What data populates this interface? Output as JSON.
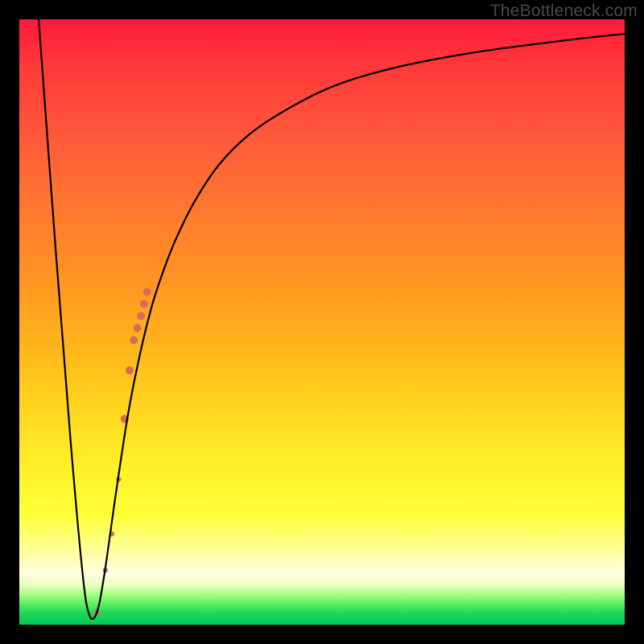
{
  "watermark": "TheBottleneck.com",
  "chart_data": {
    "type": "line",
    "title": "",
    "xlabel": "",
    "ylabel": "",
    "xlim": [
      0,
      100
    ],
    "ylim": [
      0,
      100
    ],
    "curve": {
      "x": [
        3.2,
        6,
        8.5,
        10.5,
        11.6,
        12.8,
        14,
        16,
        18,
        20,
        22,
        24,
        26,
        29,
        33,
        38,
        44,
        52,
        62,
        75,
        90,
        100
      ],
      "y": [
        100,
        62,
        30,
        8,
        1.5,
        2,
        8,
        22,
        35,
        45,
        53,
        59,
        64,
        70,
        76,
        81,
        85,
        89,
        92,
        94.5,
        96.5,
        97.6
      ]
    },
    "markers": {
      "x": [
        12.8,
        14.2,
        15.3,
        16.4,
        17.4,
        18.2,
        18.9,
        19.5,
        20.1,
        20.6,
        21.1
      ],
      "y": [
        2,
        9,
        15,
        24,
        34,
        42,
        47,
        49,
        51,
        53,
        55
      ],
      "size": [
        3.8,
        3.2,
        3.2,
        3.2,
        5.0,
        5.0,
        5.0,
        5.0,
        5.0,
        5.0,
        5.0
      ],
      "color": "#d86a5a"
    },
    "gradient_stops": [
      {
        "pos": 0,
        "color": "#ff1a3a"
      },
      {
        "pos": 50,
        "color": "#ffb81a"
      },
      {
        "pos": 82,
        "color": "#ffff38"
      },
      {
        "pos": 95,
        "color": "#a8ff88"
      },
      {
        "pos": 100,
        "color": "#00c858"
      }
    ]
  }
}
